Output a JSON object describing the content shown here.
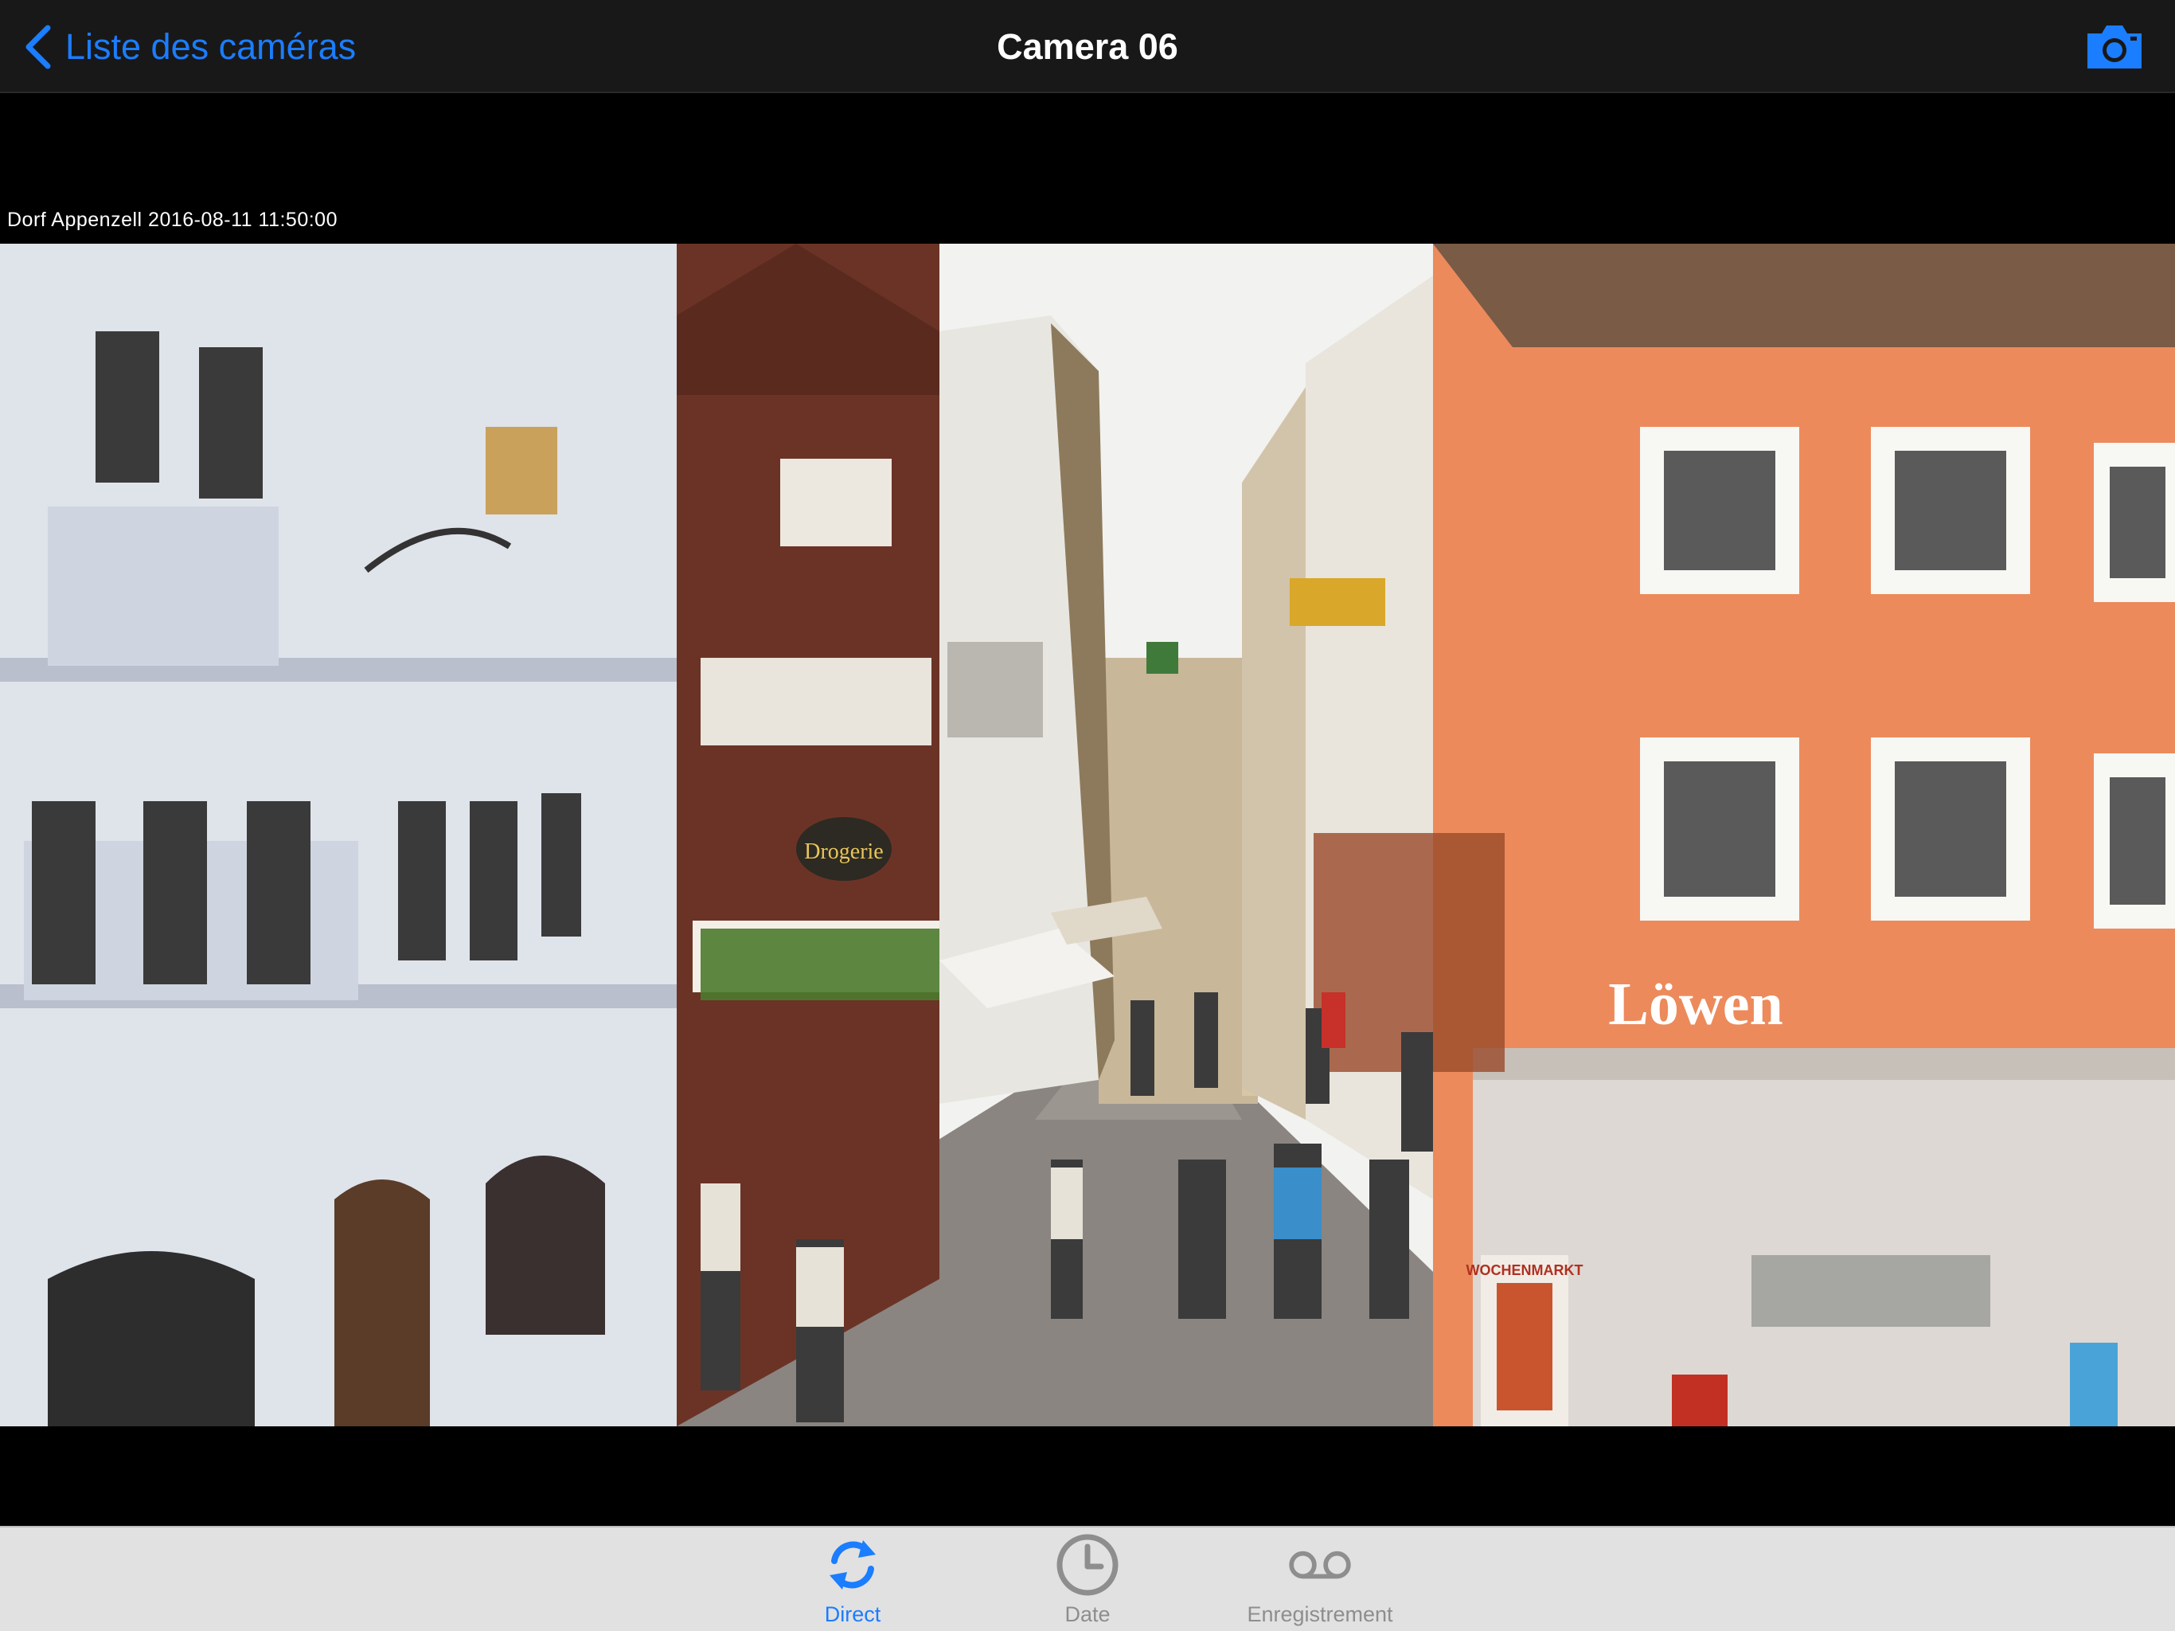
{
  "navbar": {
    "back_label": "Liste des caméras",
    "title": "Camera 06",
    "snapshot_icon": "camera-icon"
  },
  "video": {
    "overlay_text": "Dorf Appenzell 2016-08-11 11:50:00",
    "shop_sign_text": "Löwen",
    "drogerie_text": "Drogerie",
    "wochenmarkt_text": "WOCHENMARKT"
  },
  "tabs": [
    {
      "label": "Direct",
      "icon": "refresh-icon",
      "active": true
    },
    {
      "label": "Date",
      "icon": "clock-icon",
      "active": false
    },
    {
      "label": "Enregistrement",
      "icon": "recording-icon",
      "active": false
    }
  ],
  "colors": {
    "accent": "#1b7dff",
    "navbar_bg": "#181818",
    "tabbar_bg": "#e1e1e1",
    "inactive": "#8e8e8e"
  }
}
